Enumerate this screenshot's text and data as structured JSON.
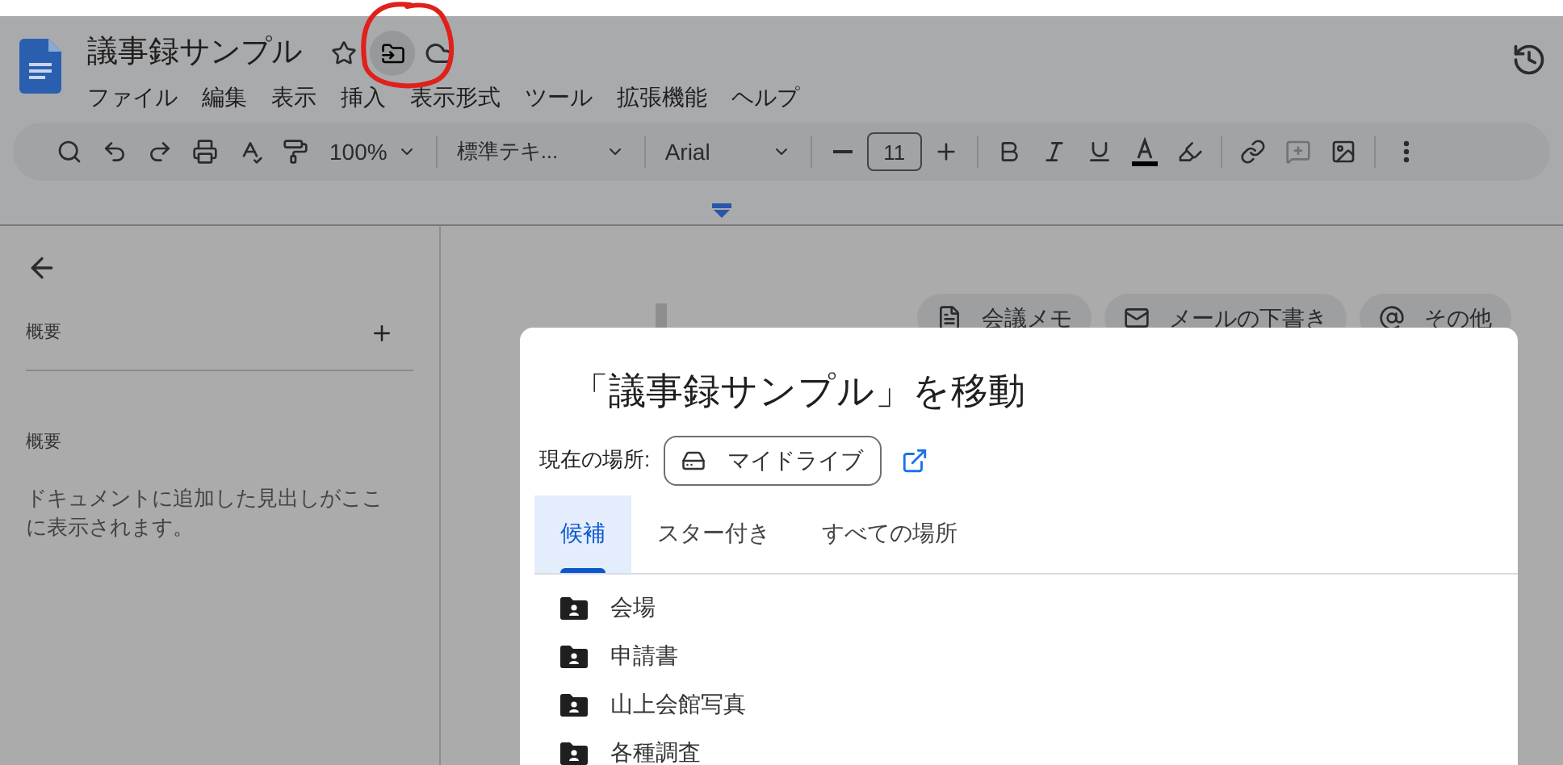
{
  "document": {
    "title": "議事録サンプル"
  },
  "menu": [
    "ファイル",
    "編集",
    "表示",
    "挿入",
    "表示形式",
    "ツール",
    "拡張機能",
    "ヘルプ"
  ],
  "toolbar": {
    "zoom": "100%",
    "style": "標準テキ...",
    "font": "Arial",
    "font_size": "11"
  },
  "outline": {
    "heading": "概要",
    "section": "概要",
    "empty_text": "ドキュメントに追加した見出しがここに表示されます。"
  },
  "chips": [
    {
      "label": "会議メモ",
      "kind": "doc"
    },
    {
      "label": "メールの下書き",
      "kind": "mail"
    },
    {
      "label": "その他",
      "kind": "at"
    }
  ],
  "dialog": {
    "title": "「議事録サンプル」を移動",
    "location_label": "現在の場所:",
    "location": "マイドライブ",
    "tabs": [
      {
        "label": "候補",
        "selected": true
      },
      {
        "label": "スター付き",
        "selected": false
      },
      {
        "label": "すべての場所",
        "selected": false
      }
    ],
    "folders": [
      "会場",
      "申請書",
      "山上会館写真",
      "各種調査"
    ]
  }
}
